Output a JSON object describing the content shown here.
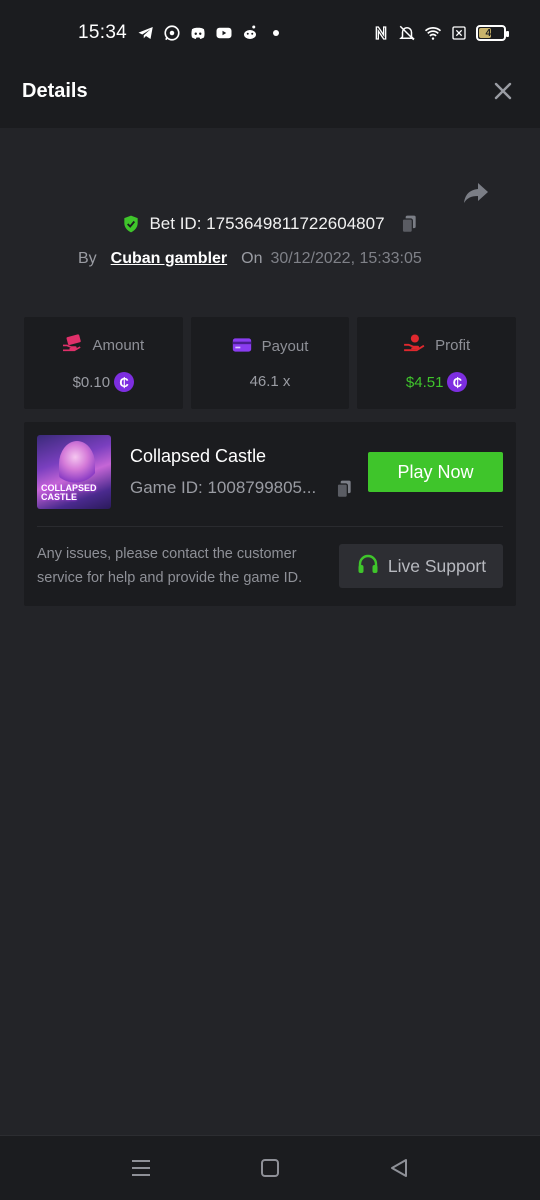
{
  "status_bar": {
    "time": "15:34",
    "left_icons": [
      "telegram-icon",
      "whatsapp-icon",
      "discord-icon",
      "youtube-icon",
      "reddit-icon",
      "dot-icon"
    ],
    "right_icons": [
      "nfc-icon",
      "bell-off-icon",
      "wifi-icon",
      "sim-off-icon"
    ],
    "battery": "46"
  },
  "header": {
    "title": "Details",
    "close_icon": "close-icon"
  },
  "bet": {
    "id_text": "Bet ID: 1753649811722604807",
    "by_label": "By",
    "user": "Cuban gambler",
    "on_label": "On",
    "datetime": "30/12/2022, 15:33:05"
  },
  "stats": {
    "amount": {
      "label": "Amount",
      "value": "$0.10"
    },
    "payout": {
      "label": "Payout",
      "value": "46.1 x"
    },
    "profit": {
      "label": "Profit",
      "value": "$4.51"
    }
  },
  "game": {
    "name": "Collapsed Castle",
    "id_text": "Game ID: 1008799805...",
    "thumb_logo_line1": "COLLAPSED",
    "thumb_logo_line2": "CASTLE",
    "play_label": "Play Now",
    "support_text": "Any issues, please contact the customer service for help and provide the game ID.",
    "support_label": "Live Support"
  },
  "colors": {
    "accent_green": "#3fc52b",
    "coin_purple": "#7d2ee0",
    "amount_icon": "#e0306a",
    "payout_icon": "#8a3cf0",
    "profit_icon": "#e0282e"
  }
}
